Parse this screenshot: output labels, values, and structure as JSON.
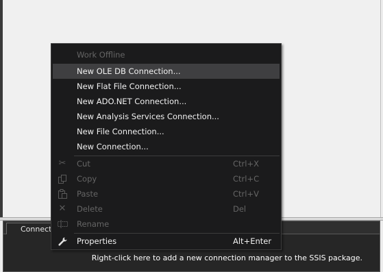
{
  "connection_pane": {
    "tab_label": "Connection Managers",
    "hint": "Right-click here to add a new connection manager to the SSIS package."
  },
  "context_menu": {
    "items": [
      {
        "label": "Work Offline",
        "shortcut": "",
        "icon": "",
        "enabled": false,
        "hover": false
      },
      {
        "label": "New OLE DB Connection...",
        "shortcut": "",
        "icon": "",
        "enabled": true,
        "hover": true
      },
      {
        "label": "New Flat File Connection...",
        "shortcut": "",
        "icon": "",
        "enabled": true,
        "hover": false
      },
      {
        "label": "New ADO.NET Connection...",
        "shortcut": "",
        "icon": "",
        "enabled": true,
        "hover": false
      },
      {
        "label": "New Analysis Services Connection...",
        "shortcut": "",
        "icon": "",
        "enabled": true,
        "hover": false
      },
      {
        "label": "New File Connection...",
        "shortcut": "",
        "icon": "",
        "enabled": true,
        "hover": false
      },
      {
        "label": "New Connection...",
        "shortcut": "",
        "icon": "",
        "enabled": true,
        "hover": false
      },
      {
        "label": "Cut",
        "shortcut": "Ctrl+X",
        "icon": "scissors-icon",
        "enabled": false,
        "hover": false
      },
      {
        "label": "Copy",
        "shortcut": "Ctrl+C",
        "icon": "copy-icon",
        "enabled": false,
        "hover": false
      },
      {
        "label": "Paste",
        "shortcut": "Ctrl+V",
        "icon": "paste-icon",
        "enabled": false,
        "hover": false
      },
      {
        "label": "Delete",
        "shortcut": "Del",
        "icon": "delete-icon",
        "enabled": false,
        "hover": false
      },
      {
        "label": "Rename",
        "shortcut": "",
        "icon": "rename-icon",
        "enabled": false,
        "hover": false
      },
      {
        "label": "Properties",
        "shortcut": "Alt+Enter",
        "icon": "wrench-icon",
        "enabled": true,
        "hover": false
      }
    ]
  },
  "colors": {
    "menu_background": "#1b1b1c",
    "menu_hover": "#3f3f41",
    "menu_text": "#f1f1f1",
    "menu_disabled_text": "#656565",
    "designer_background": "#f0f0f0",
    "pane_background": "#262626"
  }
}
